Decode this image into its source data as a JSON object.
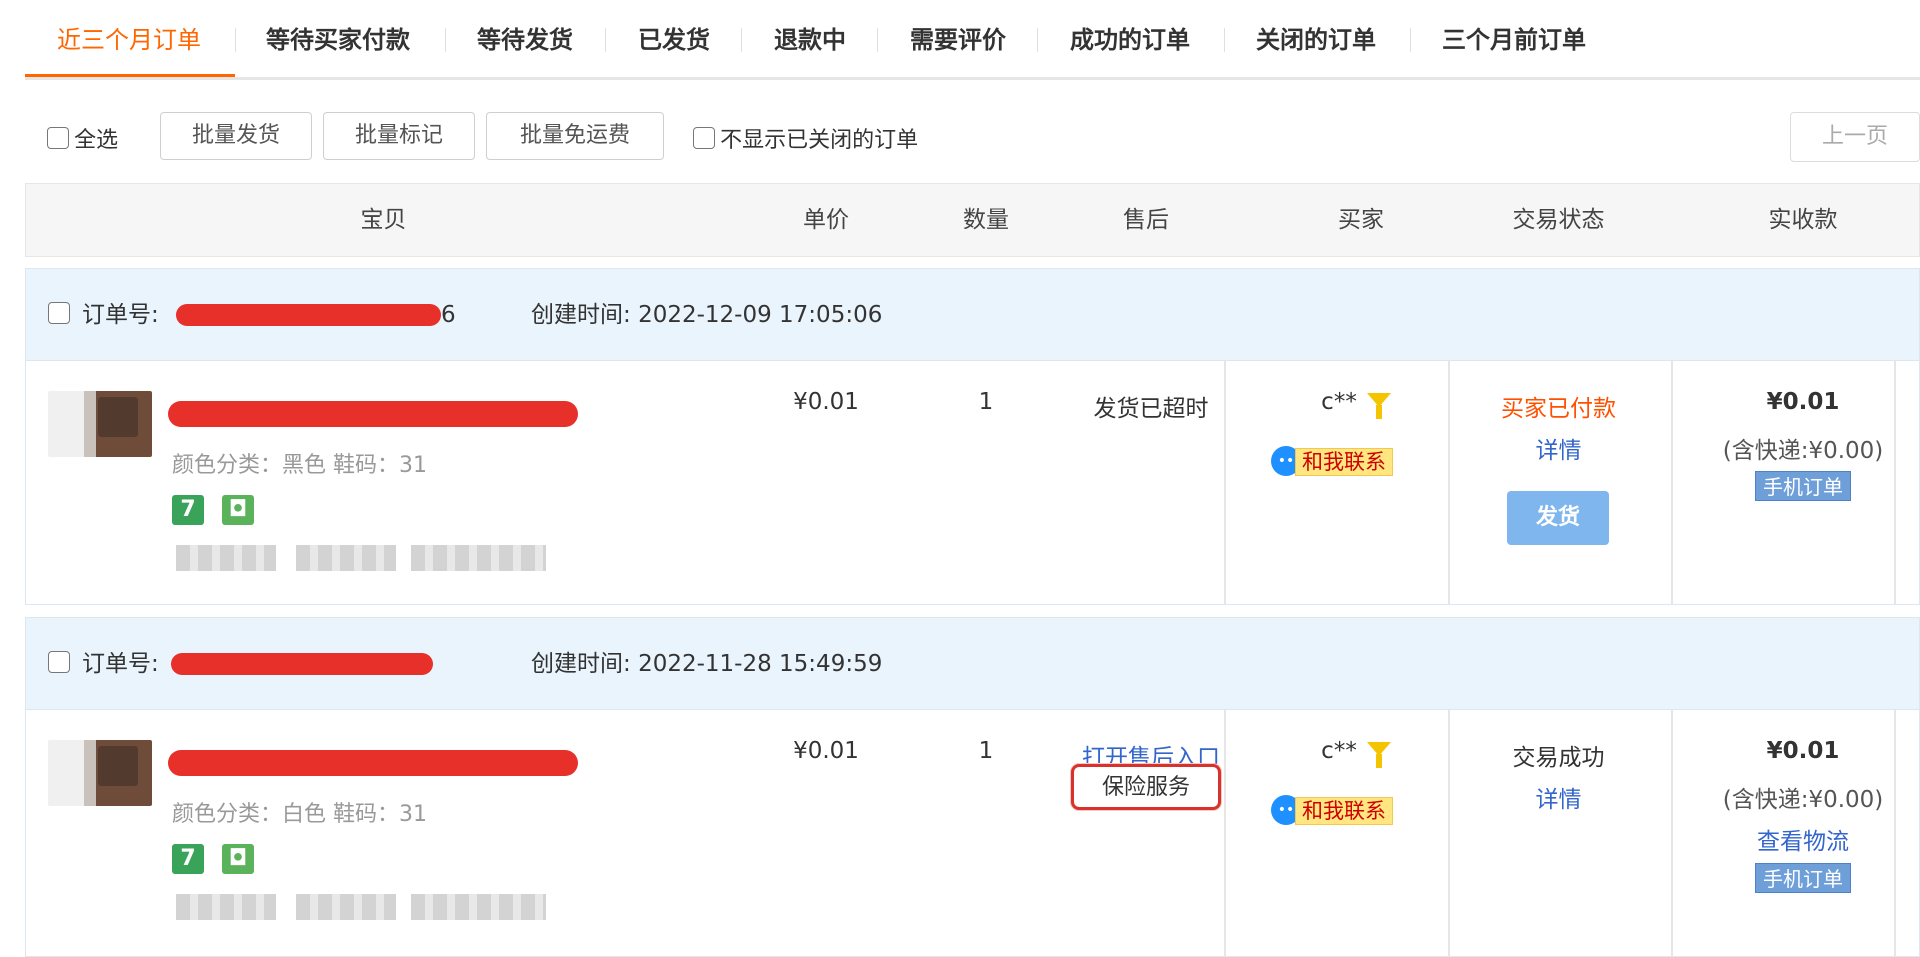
{
  "tabs": [
    {
      "label": "近三个月订单",
      "active": true
    },
    {
      "label": "等待买家付款"
    },
    {
      "label": "等待发货"
    },
    {
      "label": "已发货"
    },
    {
      "label": "退款中"
    },
    {
      "label": "需要评价"
    },
    {
      "label": "成功的订单"
    },
    {
      "label": "关闭的订单"
    },
    {
      "label": "三个月前订单"
    }
  ],
  "toolbar": {
    "select_all": "全选",
    "batch_ship": "批量发货",
    "batch_mark": "批量标记",
    "batch_free_shipping": "批量免运费",
    "hide_closed": "不显示已关闭的订单",
    "prev_page": "上一页"
  },
  "columns": {
    "item": "宝贝",
    "price": "单价",
    "qty": "数量",
    "after_sale": "售后",
    "buyer": "买家",
    "status": "交易状态",
    "received": "实收款"
  },
  "orders": [
    {
      "order_no_label": "订单号:",
      "order_no_tail": "6",
      "created_label": "创建时间:",
      "created_time": "2022-12-09 17:05:06",
      "sku": "颜色分类：黑色   鞋码：31",
      "badge_seven": "7",
      "price": "¥0.01",
      "qty": "1",
      "after_sale": "发货已超时",
      "buyer": "c**",
      "contact": "和我联系",
      "status": "买家已付款",
      "detail": "详情",
      "ship_button": "发货",
      "total": "¥0.01",
      "shipping_note": "(含快递:¥0.00)",
      "mobile_tag": "手机订单"
    },
    {
      "order_no_label": "订单号:",
      "created_label": "创建时间:",
      "created_time": "2022-11-28 15:49:59",
      "sku": "颜色分类：白色   鞋码：31",
      "badge_seven": "7",
      "price": "¥0.01",
      "qty": "1",
      "after_sale_link": "打开售后入口",
      "insurance": "保险服务",
      "buyer": "c**",
      "contact": "和我联系",
      "status": "交易成功",
      "detail": "详情",
      "total": "¥0.01",
      "shipping_note": "(含快递:¥0.00)",
      "logistics": "查看物流",
      "mobile_tag": "手机订单"
    }
  ],
  "colors": {
    "accent": "#ff6600",
    "link": "#3366cc",
    "paid_status": "#ff5000",
    "ship_button": "#7fb6ee",
    "order_header_bg": "#eaf4fc",
    "highlight_box": "#d9322a"
  },
  "icons": [
    "checkbox-icon",
    "funnel-icon",
    "chat-bubble-icon",
    "seven-day-return-icon",
    "bag-icon"
  ]
}
